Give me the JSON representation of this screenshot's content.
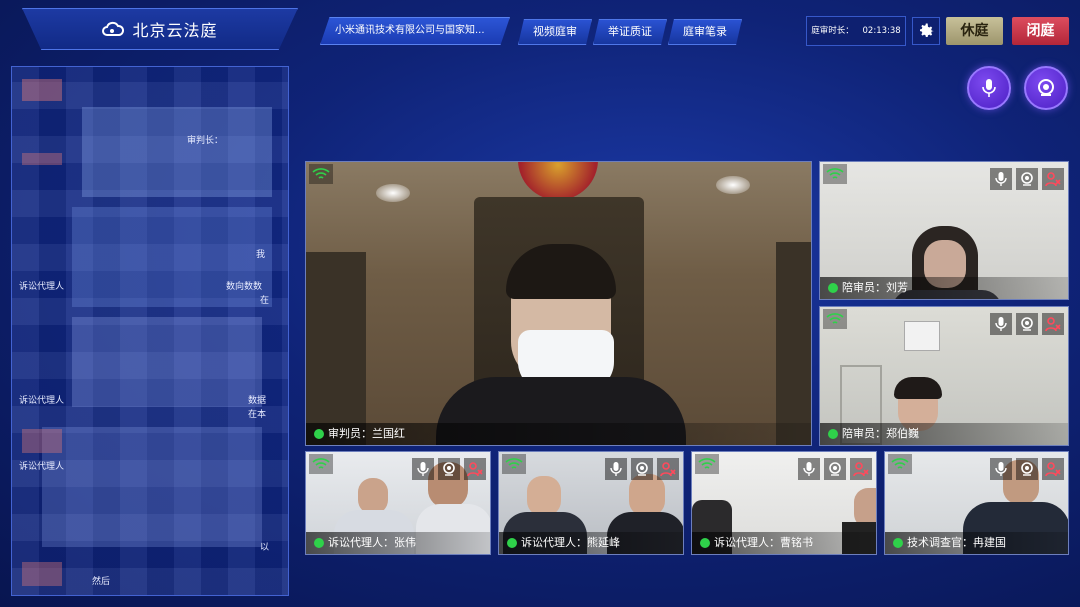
{
  "header": {
    "app_title": "北京云法庭",
    "case_title": "小米通讯技术有限公司与国家知...",
    "tabs": [
      {
        "label": "视频庭审"
      },
      {
        "label": "举证质证"
      },
      {
        "label": "庭审笔录"
      }
    ],
    "duration_label": "庭审时长：",
    "duration_value": "02:13:38",
    "recess_label": "休庭",
    "close_label": "闭庭"
  },
  "colors": {
    "accent": "#1b3cb3",
    "live_dot": "#2fd14a",
    "close_button": "#c93447",
    "recess_button": "#b8b085",
    "round_button": "#5a2bd6"
  },
  "icons": {
    "logo": "cloud-icon",
    "settings": "gear-icon",
    "mic": "microphone-icon",
    "camera": "webcam-icon",
    "signal": "wifi-icon",
    "remove_user": "user-remove-icon"
  },
  "transcript": {
    "fragments": [
      "诉讼代理人",
      "诉讼代理人",
      "审判长：",
      "诉讼代理人",
      "数据",
      "在本",
      "以",
      "然后",
      "我",
      "数向数数",
      "在"
    ]
  },
  "participants": [
    {
      "id": "judge",
      "label": "审判员：兰国红"
    },
    {
      "id": "juror1",
      "label": "陪审员：刘芳"
    },
    {
      "id": "juror2",
      "label": "陪审员：郑伯巍"
    },
    {
      "id": "agent1",
      "label": "诉讼代理人：张伟"
    },
    {
      "id": "agent2",
      "label": "诉讼代理人：熊延峰"
    },
    {
      "id": "agent3",
      "label": "诉讼代理人：曹铭书"
    },
    {
      "id": "investigator",
      "label": "技术调查官：冉建国"
    }
  ]
}
